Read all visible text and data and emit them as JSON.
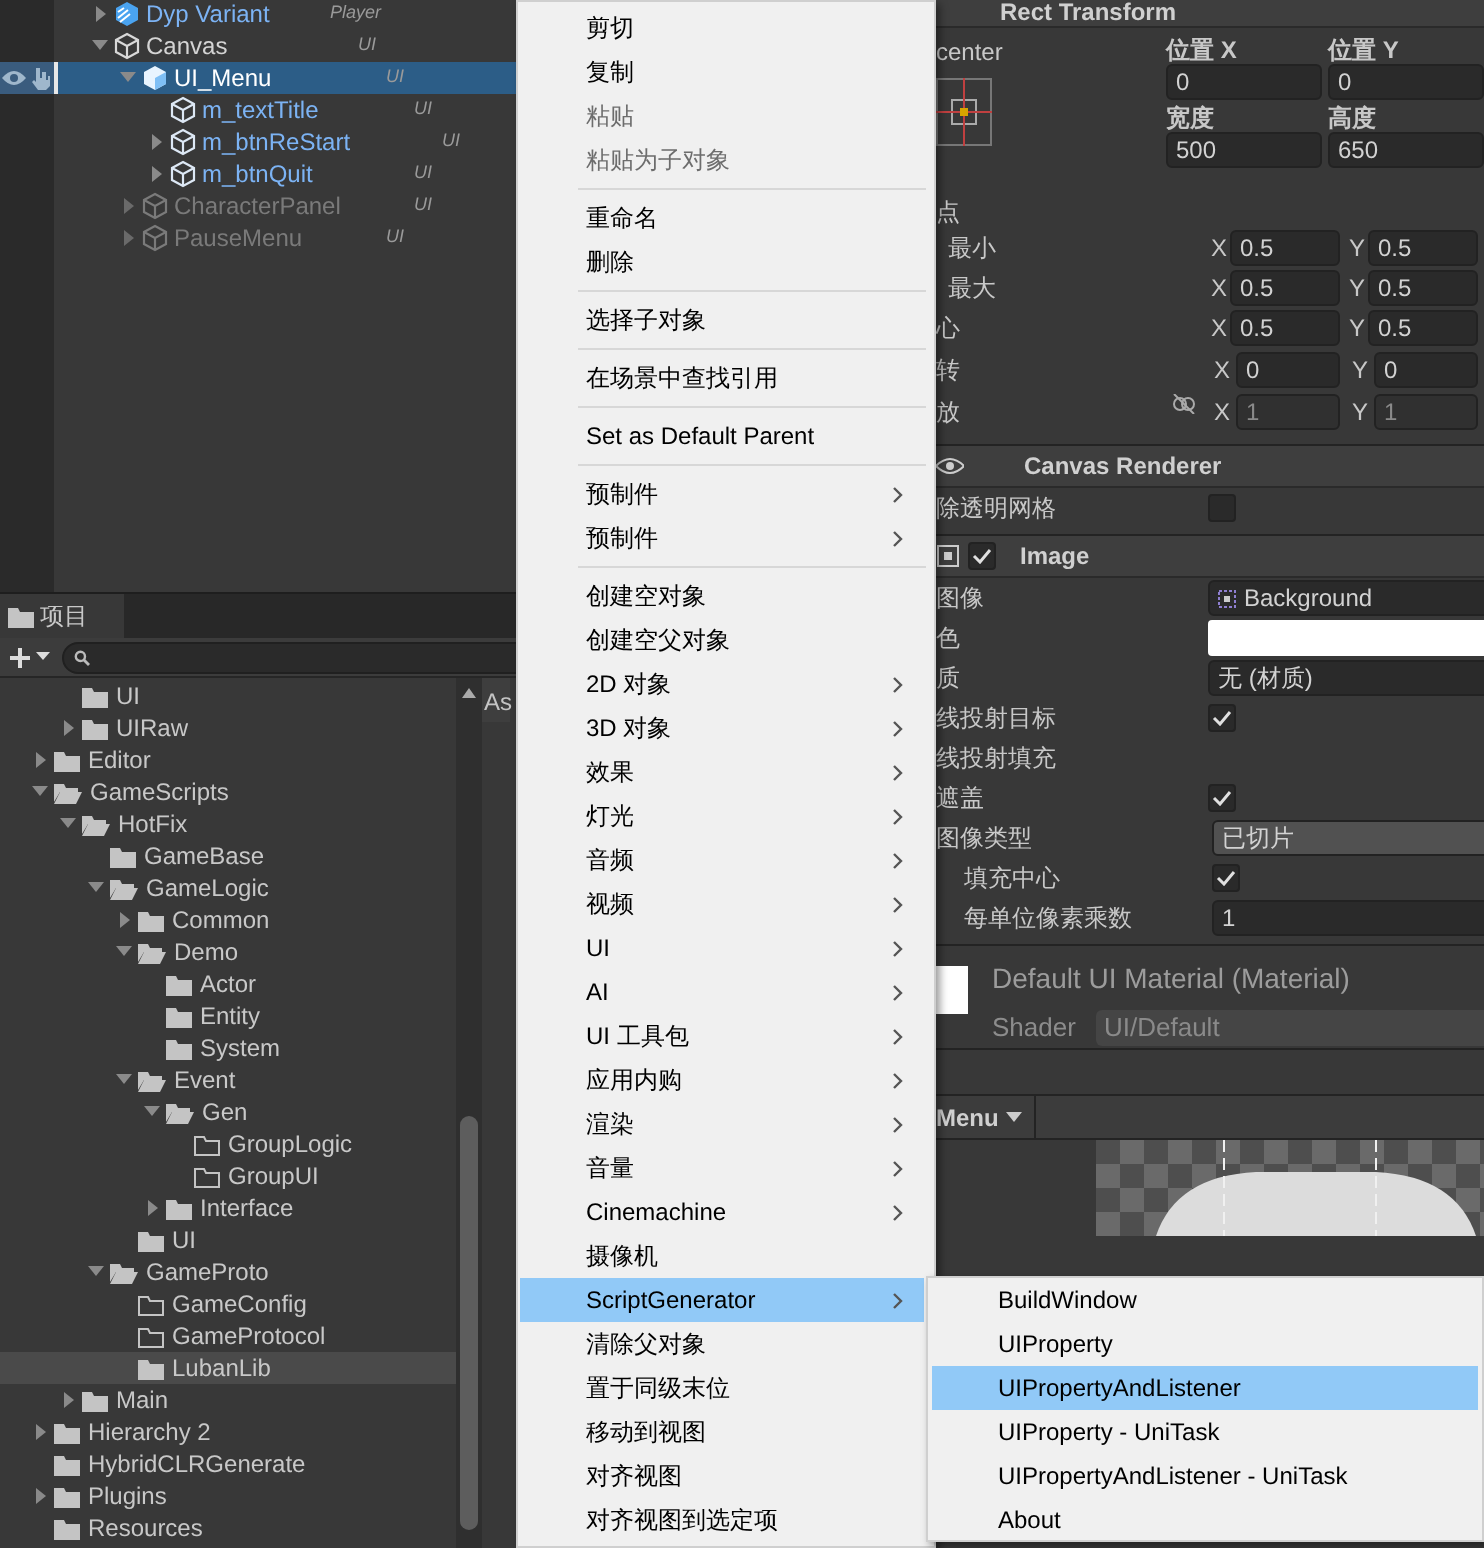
{
  "hierarchy": {
    "rows": [
      {
        "label": "Dyp Variant",
        "kind": "variant",
        "tag": "Player",
        "expanded": false,
        "selected": false
      },
      {
        "label": "Canvas",
        "kind": "object",
        "tag": "UI",
        "expanded": true,
        "selected": false,
        "children": [
          {
            "label": "UI_Menu",
            "kind": "prefab-root",
            "tag": "UI",
            "expanded": true,
            "selected": true,
            "children": [
              {
                "label": "m_textTitle",
                "kind": "prefab",
                "tag": "UI",
                "selected": false
              },
              {
                "label": "m_btnReStart",
                "kind": "prefab",
                "tag": "UI",
                "expanded": false,
                "selected": false
              },
              {
                "label": "m_btnQuit",
                "kind": "prefab",
                "tag": "UI",
                "expanded": false,
                "selected": false
              }
            ]
          },
          {
            "label": "CharacterPanel",
            "kind": "object",
            "tag": "UI",
            "expanded": false,
            "selected": false,
            "active": false
          },
          {
            "label": "PauseMenu",
            "kind": "object",
            "tag": "UI",
            "expanded": false,
            "selected": false,
            "active": false
          }
        ]
      }
    ]
  },
  "project": {
    "tab": "项目",
    "right_header": "As",
    "tree": [
      {
        "children": [
          {
            "label": "UI",
            "selected": false,
            "empty": false
          },
          {
            "label": "UIRaw",
            "expanded": false,
            "selected": false
          }
        ]
      },
      {
        "label": "Editor",
        "expanded": false,
        "selected": false
      },
      {
        "label": "GameScripts",
        "expanded": true,
        "selected": false,
        "children": [
          {
            "label": "HotFix",
            "expanded": true,
            "selected": false,
            "children": [
              {
                "label": "GameBase",
                "selected": false,
                "empty": false
              },
              {
                "label": "GameLogic",
                "expanded": true,
                "selected": false,
                "children": [
                  {
                    "label": "Common",
                    "expanded": false,
                    "selected": false
                  },
                  {
                    "label": "Demo",
                    "expanded": true,
                    "selected": false,
                    "children": [
                      {
                        "label": "Actor",
                        "selected": false,
                        "empty": false
                      },
                      {
                        "label": "Entity",
                        "selected": false,
                        "empty": false
                      },
                      {
                        "label": "System",
                        "selected": false,
                        "empty": false
                      }
                    ]
                  },
                  {
                    "label": "Event",
                    "expanded": true,
                    "selected": false,
                    "children": [
                      {
                        "label": "Gen",
                        "expanded": true,
                        "selected": false,
                        "children": [
                          {
                            "label": "GroupLogic",
                            "selected": false,
                            "empty": true
                          },
                          {
                            "label": "GroupUI",
                            "selected": false,
                            "empty": true
                          }
                        ]
                      },
                      {
                        "label": "Interface",
                        "expanded": false,
                        "selected": false
                      }
                    ]
                  },
                  {
                    "label": "UI",
                    "selected": false,
                    "empty": false
                  }
                ]
              },
              {
                "label": "GameProto",
                "expanded": true,
                "selected": false,
                "children": [
                  {
                    "label": "GameConfig",
                    "selected": false,
                    "empty": true
                  },
                  {
                    "label": "GameProtocol",
                    "selected": false,
                    "empty": true
                  },
                  {
                    "label": "LubanLib",
                    "selected": true,
                    "empty": false
                  }
                ]
              }
            ]
          },
          {
            "label": "Main",
            "expanded": false,
            "selected": false
          }
        ]
      },
      {
        "label": "Hierarchy 2",
        "expanded": false,
        "selected": false
      },
      {
        "label": "HybridCLRGenerate",
        "selected": false,
        "empty": false
      },
      {
        "label": "Plugins",
        "expanded": false,
        "selected": false
      },
      {
        "label": "Resources",
        "selected": false,
        "empty": false
      }
    ]
  },
  "inspector": {
    "rect_transform": {
      "title": "Rect Transform",
      "anchor_preset": "center",
      "fields": [
        {
          "label": "位置 X",
          "value": "0"
        },
        {
          "label": "位置 Y",
          "value": "0"
        },
        {
          "label": "宽度",
          "value": "500"
        },
        {
          "label": "高度",
          "value": "650"
        }
      ],
      "anchors_label": "点",
      "rows": [
        {
          "label": "最小",
          "indent": true,
          "disabled": false,
          "axes": [
            {
              "axis": "X",
              "value": "0.5"
            },
            {
              "axis": "Y",
              "value": "0.5"
            }
          ]
        },
        {
          "label": "最大",
          "indent": true,
          "disabled": false,
          "axes": [
            {
              "axis": "X",
              "value": "0.5"
            },
            {
              "axis": "Y",
              "value": "0.5"
            }
          ]
        },
        {
          "label": "心",
          "indent": false,
          "disabled": false,
          "axes": [
            {
              "axis": "X",
              "value": "0.5"
            },
            {
              "axis": "Y",
              "value": "0.5"
            }
          ]
        },
        {
          "label": "转",
          "indent": false,
          "disabled": false,
          "axes": [
            {
              "axis": "X",
              "value": "0"
            },
            {
              "axis": "Y",
              "value": "0"
            }
          ]
        },
        {
          "label": "放",
          "indent": false,
          "disabled": true,
          "constrained": false,
          "axes": [
            {
              "axis": "X",
              "value": "1"
            },
            {
              "axis": "Y",
              "value": "1"
            }
          ]
        }
      ]
    },
    "components": [
      {
        "title": "Canvas Renderer",
        "kind": "renderer",
        "fields": [
          {
            "label": "除透明网格",
            "kind": "checkbox",
            "checked": false
          }
        ]
      },
      {
        "title": "Image",
        "kind": "image",
        "enabled": true,
        "fields": [
          {
            "label": "图像",
            "kind": "sprite",
            "value": "Background"
          },
          {
            "label": "色",
            "kind": "color",
            "color": "#ffffff"
          },
          {
            "label": "质",
            "kind": "object",
            "value": "无 (材质)"
          },
          {
            "label": "线投射目标",
            "kind": "checkbox",
            "checked": true
          },
          {
            "label": "线投射填充",
            "kind": "foldout"
          },
          {
            "label": "遮盖",
            "kind": "checkbox",
            "checked": true
          },
          {
            "label": "图像类型",
            "kind": "dropdown",
            "value": "已切片",
            "children": [
              {
                "label": "填充中心",
                "kind": "checkbox",
                "checked": true
              },
              {
                "label": "每单位像素乘数",
                "kind": "number",
                "value": "1"
              }
            ]
          }
        ]
      }
    ],
    "material": {
      "name": "Default UI Material (Material)",
      "shader_label": "Shader",
      "shader": "UI/Default"
    },
    "preview": {
      "title": "Menu"
    }
  },
  "context_menu": {
    "items": [
      {
        "kind": "item",
        "label": "剪切",
        "disabled": false,
        "submenu": false,
        "selected": false
      },
      {
        "kind": "item",
        "label": "复制",
        "disabled": false,
        "submenu": false,
        "selected": false
      },
      {
        "kind": "item",
        "label": "粘贴",
        "disabled": true,
        "submenu": false,
        "selected": false
      },
      {
        "kind": "item",
        "label": "粘贴为子对象",
        "disabled": true,
        "submenu": false,
        "selected": false
      },
      {
        "kind": "separator"
      },
      {
        "kind": "item",
        "label": "重命名",
        "disabled": false,
        "submenu": false,
        "selected": false
      },
      {
        "kind": "item",
        "label": "删除",
        "disabled": false,
        "submenu": false,
        "selected": false
      },
      {
        "kind": "separator"
      },
      {
        "kind": "item",
        "label": "选择子对象",
        "disabled": false,
        "submenu": false,
        "selected": false
      },
      {
        "kind": "separator"
      },
      {
        "kind": "item",
        "label": "在场景中查找引用",
        "disabled": false,
        "submenu": false,
        "selected": false
      },
      {
        "kind": "separator"
      },
      {
        "kind": "item",
        "label": "Set as Default Parent",
        "disabled": false,
        "submenu": false,
        "selected": false
      },
      {
        "kind": "separator"
      },
      {
        "kind": "item",
        "label": "预制件",
        "disabled": false,
        "submenu": true,
        "selected": false
      },
      {
        "kind": "item",
        "label": "预制件",
        "disabled": false,
        "submenu": true,
        "selected": false
      },
      {
        "kind": "separator"
      },
      {
        "kind": "item",
        "label": "创建空对象",
        "disabled": false,
        "submenu": false,
        "selected": false
      },
      {
        "kind": "item",
        "label": "创建空父对象",
        "disabled": false,
        "submenu": false,
        "selected": false
      },
      {
        "kind": "item",
        "label": "2D 对象",
        "disabled": false,
        "submenu": true,
        "selected": false
      },
      {
        "kind": "item",
        "label": "3D 对象",
        "disabled": false,
        "submenu": true,
        "selected": false
      },
      {
        "kind": "item",
        "label": "效果",
        "disabled": false,
        "submenu": true,
        "selected": false
      },
      {
        "kind": "item",
        "label": "灯光",
        "disabled": false,
        "submenu": true,
        "selected": false
      },
      {
        "kind": "item",
        "label": "音频",
        "disabled": false,
        "submenu": true,
        "selected": false
      },
      {
        "kind": "item",
        "label": "视频",
        "disabled": false,
        "submenu": true,
        "selected": false
      },
      {
        "kind": "item",
        "label": "UI",
        "disabled": false,
        "submenu": true,
        "selected": false
      },
      {
        "kind": "item",
        "label": "AI",
        "disabled": false,
        "submenu": true,
        "selected": false
      },
      {
        "kind": "item",
        "label": "UI 工具包",
        "disabled": false,
        "submenu": true,
        "selected": false
      },
      {
        "kind": "item",
        "label": "应用内购",
        "disabled": false,
        "submenu": true,
        "selected": false
      },
      {
        "kind": "item",
        "label": "渲染",
        "disabled": false,
        "submenu": true,
        "selected": false
      },
      {
        "kind": "item",
        "label": "音量",
        "disabled": false,
        "submenu": true,
        "selected": false
      },
      {
        "kind": "item",
        "label": "Cinemachine",
        "disabled": false,
        "submenu": true,
        "selected": false
      },
      {
        "kind": "item",
        "label": "摄像机",
        "disabled": false,
        "submenu": false,
        "selected": false
      },
      {
        "kind": "item",
        "label": "ScriptGenerator",
        "disabled": false,
        "submenu": true,
        "selected": true
      },
      {
        "kind": "item",
        "label": "清除父对象",
        "disabled": false,
        "submenu": false,
        "selected": false
      },
      {
        "kind": "item",
        "label": "置于同级末位",
        "disabled": false,
        "submenu": false,
        "selected": false
      },
      {
        "kind": "item",
        "label": "移动到视图",
        "disabled": false,
        "submenu": false,
        "selected": false
      },
      {
        "kind": "item",
        "label": "对齐视图",
        "disabled": false,
        "submenu": false,
        "selected": false
      },
      {
        "kind": "item",
        "label": "对齐视图到选定项",
        "disabled": false,
        "submenu": false,
        "selected": false
      }
    ]
  },
  "submenu": {
    "items": [
      {
        "label": "BuildWindow",
        "selected": false
      },
      {
        "label": "UIProperty",
        "selected": false
      },
      {
        "label": "UIPropertyAndListener",
        "selected": true
      },
      {
        "label": "UIProperty - UniTask",
        "selected": false
      },
      {
        "label": "UIPropertyAndListener - UniTask",
        "selected": false
      },
      {
        "label": "About",
        "selected": false
      }
    ]
  }
}
